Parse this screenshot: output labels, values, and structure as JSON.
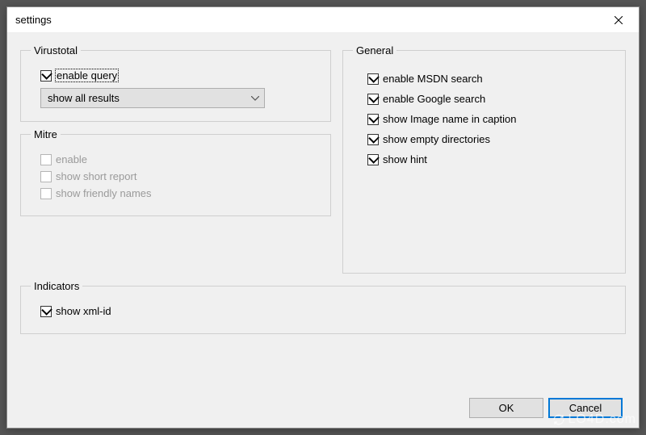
{
  "window": {
    "title": "settings"
  },
  "groups": {
    "virustotal": {
      "legend": "Virustotal",
      "enable_query": {
        "label": "enable query",
        "checked": true
      },
      "combo": {
        "value": "show all results"
      }
    },
    "mitre": {
      "legend": "Mitre",
      "enable": {
        "label": "enable",
        "checked": false,
        "disabled": true
      },
      "short_report": {
        "label": "show short report",
        "checked": false,
        "disabled": true
      },
      "friendly_names": {
        "label": "show friendly names",
        "checked": false,
        "disabled": true
      }
    },
    "indicators": {
      "legend": "Indicators",
      "xml_id": {
        "label": "show xml-id",
        "checked": true
      }
    },
    "general": {
      "legend": "General",
      "items": [
        {
          "key": "msdn",
          "label": "enable MSDN search",
          "checked": true
        },
        {
          "key": "google",
          "label": "enable Google search",
          "checked": true
        },
        {
          "key": "image_caption",
          "label": "show Image name in caption",
          "checked": true
        },
        {
          "key": "empty_dirs",
          "label": "show empty directories",
          "checked": true
        },
        {
          "key": "hint",
          "label": "show hint",
          "checked": true
        }
      ]
    }
  },
  "buttons": {
    "ok": "OK",
    "cancel": "Cancel"
  },
  "watermark": "LO4D.com"
}
